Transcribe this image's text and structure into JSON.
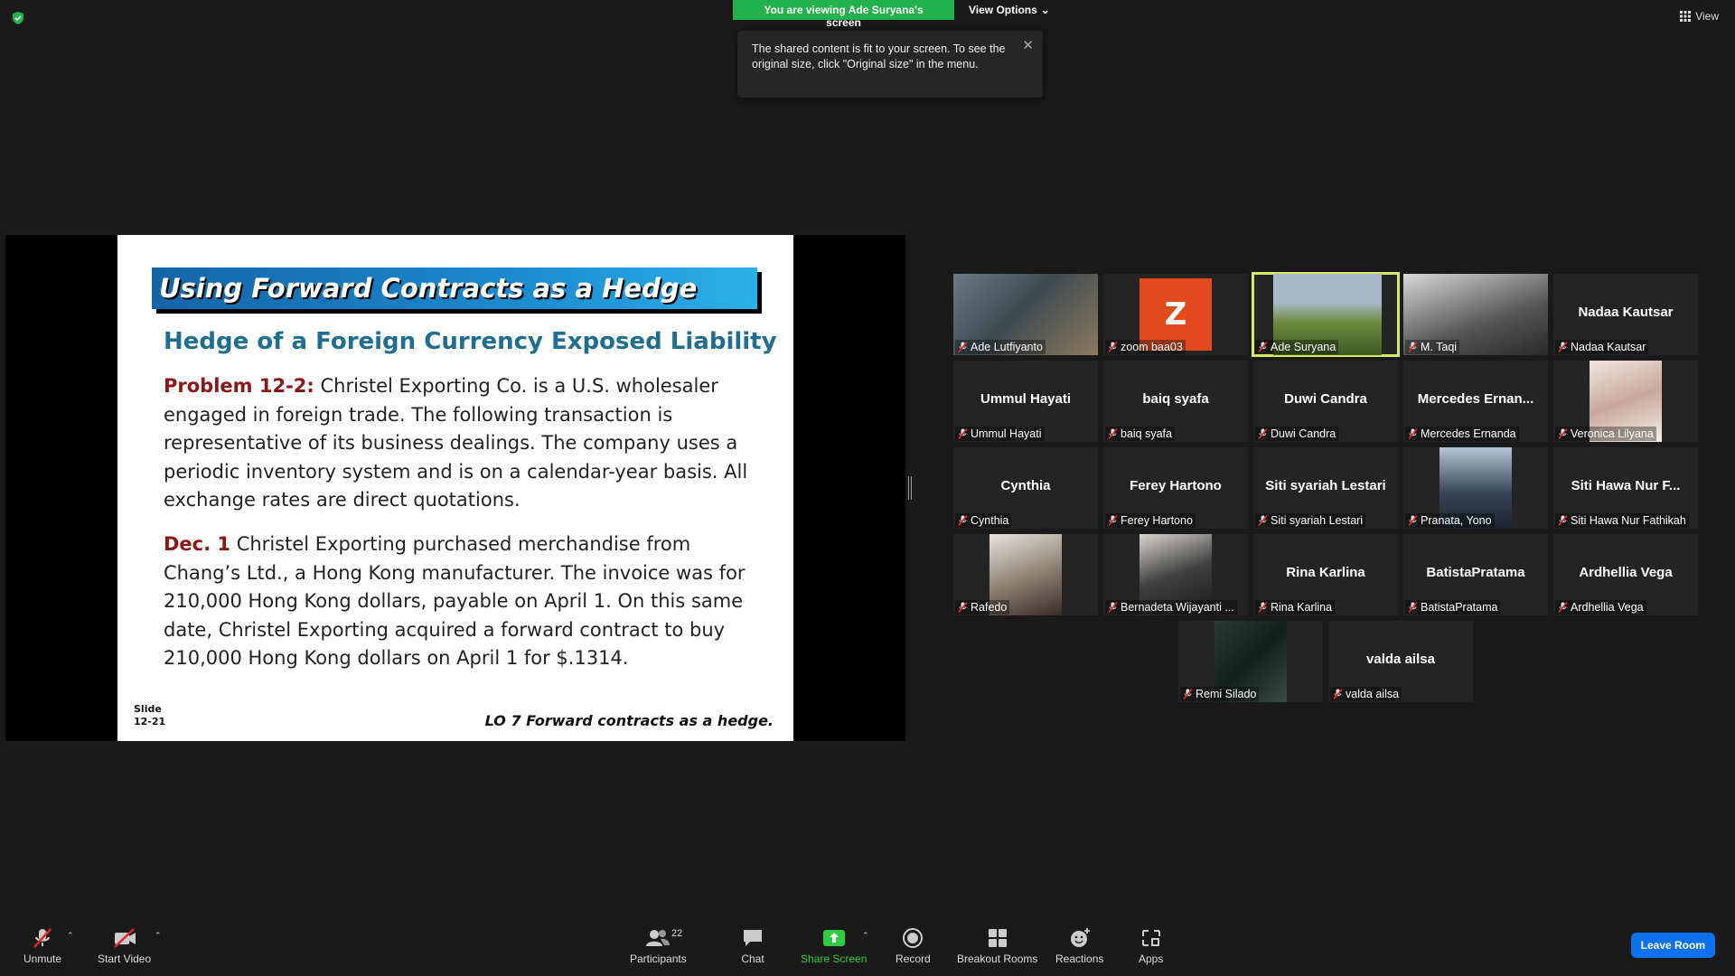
{
  "banner": {
    "viewing": "You are viewing Ade Suryana's screen",
    "view_options": "View Options"
  },
  "tooltip": {
    "text": "The shared content is fit to your screen. To see the original size, click \"Original size\" in the menu."
  },
  "view_button": "View",
  "slide": {
    "title": "Using Forward Contracts as a Hedge",
    "subtitle": "Hedge of a Foreign Currency Exposed Liability",
    "p1_lead": "Problem 12-2:",
    "p1_text": " Christel Exporting Co. is a U.S. wholesaler engaged in foreign trade. The following transaction is representative of its business dealings. The company uses a periodic inventory system and is on a calendar-year basis. All exchange rates are direct quotations.",
    "p2_lead": "Dec. 1",
    "p2_text": " Christel Exporting purchased merchandise from Chang’s Ltd., a Hong Kong manufacturer. The invoice was for 210,000 Hong Kong dollars, payable on April 1. On this same date, Christel Exporting acquired a forward contract to buy 210,000 Hong Kong dollars on April 1 for $.1314.",
    "slide_label": "Slide",
    "slide_number": "12-21",
    "lo": "LO 7  Forward contracts as a hedge."
  },
  "participants": [
    {
      "label": "Ade Lutfiyanto",
      "display": ""
    },
    {
      "label": "zoom baa03",
      "display": "Z"
    },
    {
      "label": "Ade Suryana",
      "display": ""
    },
    {
      "label": "M. Taqi",
      "display": ""
    },
    {
      "label": "Nadaa Kautsar",
      "display": "Nadaa Kautsar"
    },
    {
      "label": "Ummul Hayati",
      "display": "Ummul Hayati"
    },
    {
      "label": "baiq syafa",
      "display": "baiq syafa"
    },
    {
      "label": "Duwi Candra",
      "display": "Duwi Candra"
    },
    {
      "label": "Mercedes Ernanda",
      "display": "Mercedes  Ernan..."
    },
    {
      "label": "Veronica Lilyana",
      "display": ""
    },
    {
      "label": "Cynthia",
      "display": "Cynthia"
    },
    {
      "label": "Ferey Hartono",
      "display": "Ferey Hartono"
    },
    {
      "label": "Siti syariah Lestari",
      "display": "Siti syariah Lestari"
    },
    {
      "label": "Pranata, Yono",
      "display": ""
    },
    {
      "label": "Siti Hawa Nur Fathikah",
      "display": "Siti Hawa Nur F..."
    },
    {
      "label": "Rafedo",
      "display": ""
    },
    {
      "label": "Bernadeta Wijayanti ...",
      "display": ""
    },
    {
      "label": "Rina Karlina",
      "display": "Rina Karlina"
    },
    {
      "label": "BatistaPratama",
      "display": "BatistaPratama"
    },
    {
      "label": "Ardhellia Vega",
      "display": "Ardhellia Vega"
    },
    {
      "label": "Remi Silado",
      "display": ""
    },
    {
      "label": "valda ailsa",
      "display": "valda ailsa"
    }
  ],
  "toolbar": {
    "unmute": "Unmute",
    "start_video": "Start Video",
    "participants": "Participants",
    "participants_count": "22",
    "chat": "Chat",
    "share_screen": "Share Screen",
    "record": "Record",
    "breakout": "Breakout Rooms",
    "reactions": "Reactions",
    "apps": "Apps",
    "leave": "Leave Room"
  },
  "colors": {
    "banner_green": "#22b14c",
    "active_speaker": "#d8e86a",
    "leave_blue": "#0e72ed",
    "share_green": "#2ecc40"
  }
}
